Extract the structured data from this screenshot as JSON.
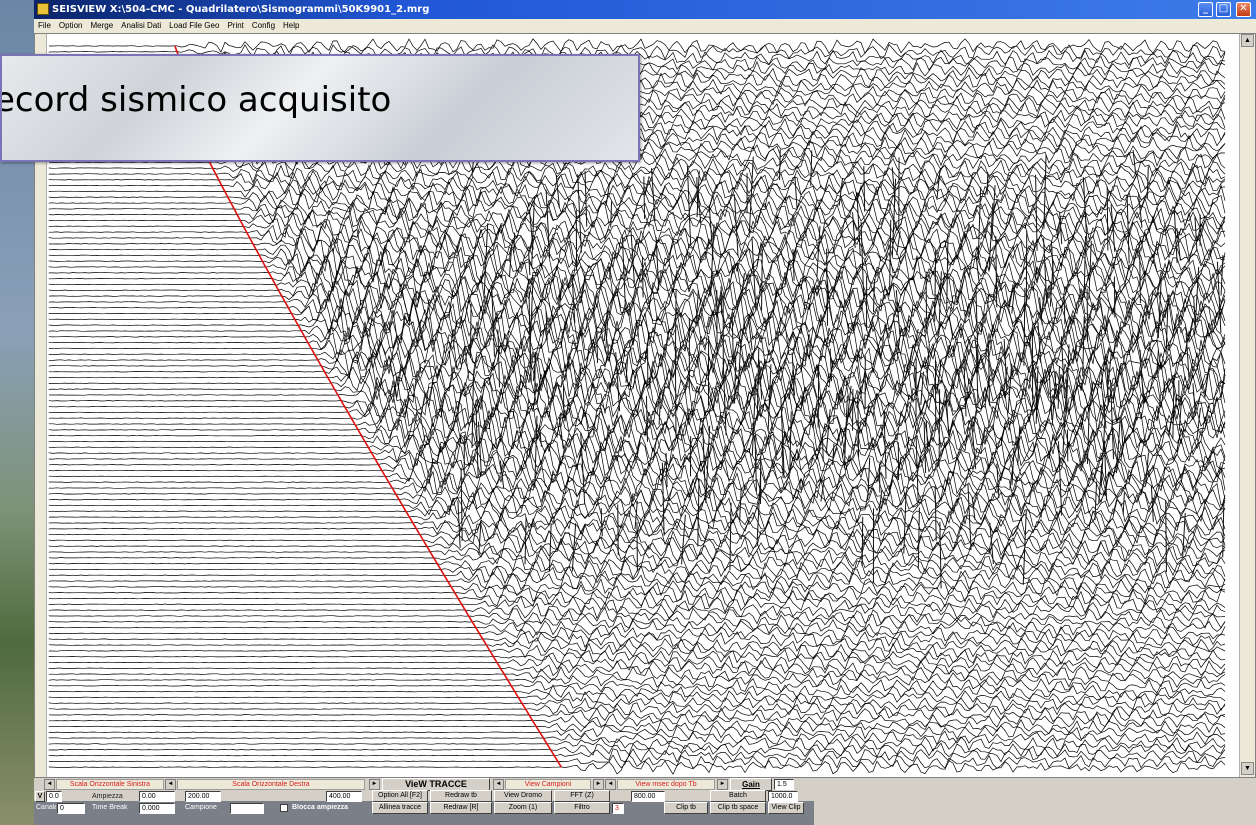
{
  "window": {
    "title": "SEISVIEW  X:\\504-CMC - Quadrilatero\\Sismogrammi\\50K9901_2.mrg",
    "controls": {
      "minimize": "_",
      "maximize": "□",
      "close": "✕"
    }
  },
  "menu": [
    "File",
    "Option",
    "Merge",
    "Analisi Dati",
    "Load File Geo",
    "Print",
    "Config",
    "Help"
  ],
  "overlay": {
    "text": "ecord sismico acquisito"
  },
  "controls": {
    "arrow_left": "◄",
    "arrow_right": "►",
    "scala_sx_label": "Scala Orizzontale Sinistra",
    "scala_dx_label": "Scala Orizzontale Destra",
    "view_tracce": "VieW TRACCE",
    "view_campioni_label": "View Campioni",
    "view_msec_label": "View msec dopo Tb",
    "gain_label": "Gain",
    "gain_value": "1.5",
    "v_button": "V",
    "v_value": "0.0",
    "ampiezza_label": "Ampiezza",
    "ampiezza_value": "0.00",
    "scala_sx_value": "200.00",
    "scala_dx_value": "400.00",
    "option_all": "Option All [F2]",
    "redraw_tb": "Redraw tb",
    "view_dromo": "View Dromo",
    "fft": "FFT (Z)",
    "msec_value": "800.00",
    "batch": "Batch",
    "batch_value": "1000.0",
    "canale_label": "Canale",
    "canale_value": "0",
    "time_break_label": "Time Break",
    "time_break_value": "0.000",
    "campione_label": "Campione",
    "campione_value": "",
    "blocca_ampiezza": "Blocca ampiezza",
    "allinea_tracce": "Allinea tracce",
    "redraw_r": "Redraw [R]",
    "zoom": "Zoom (1)",
    "filtro": "Filtro",
    "filtro_value": "3",
    "clip_tb": "Clip tb",
    "clip_tb_space": "Clip tb space",
    "view_clip": "View Clip"
  },
  "colors": {
    "traces": "#000000",
    "picks": "#e01010",
    "title_bar": "#2157d6",
    "overlay_border": "#7b73b8"
  }
}
